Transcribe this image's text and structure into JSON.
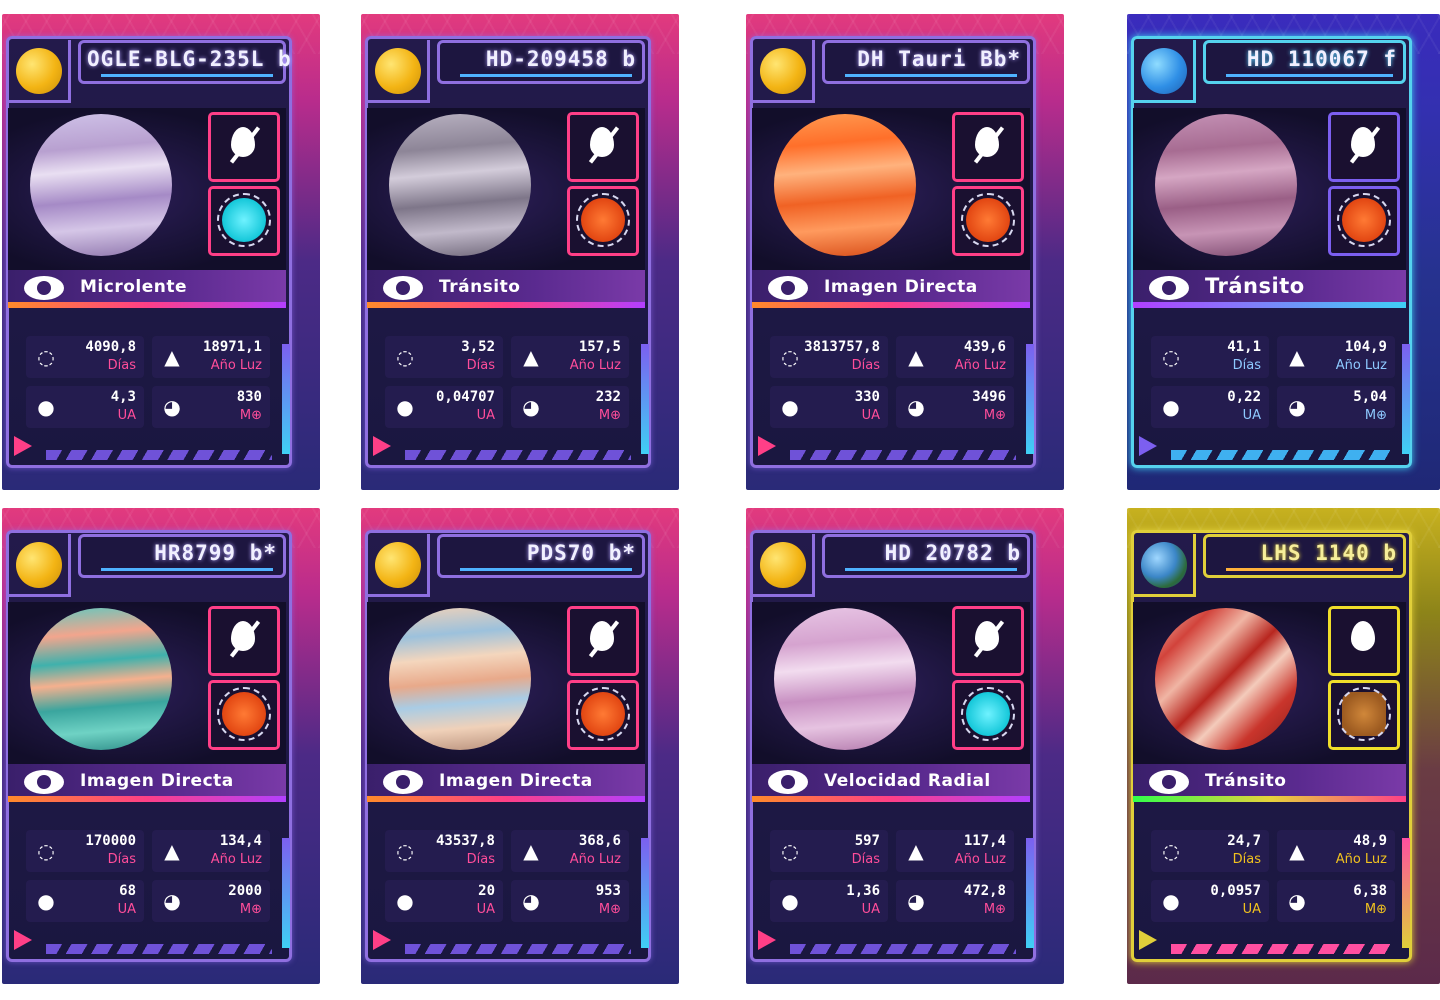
{
  "cards": [
    {
      "title": "OGLE-BLG-235L b",
      "method": "Microlente",
      "stats": [
        {
          "value": "4090,8",
          "unit": "Días"
        },
        {
          "value": "18971,1",
          "unit": "Año Luz"
        },
        {
          "value": "4,3",
          "unit": "UA"
        },
        {
          "value": "830",
          "unit": "M⊕"
        }
      ]
    },
    {
      "title": "HD-209458 b",
      "method": "Tránsito",
      "stats": [
        {
          "value": "3,52",
          "unit": "Días"
        },
        {
          "value": "157,5",
          "unit": "Año Luz"
        },
        {
          "value": "0,04707",
          "unit": "UA"
        },
        {
          "value": "232",
          "unit": "M⊕"
        }
      ]
    },
    {
      "title": "DH Tauri Bb*",
      "method": "Imagen Directa",
      "stats": [
        {
          "value": "3813757,8",
          "unit": "Días"
        },
        {
          "value": "439,6",
          "unit": "Año Luz"
        },
        {
          "value": "330",
          "unit": "UA"
        },
        {
          "value": "3496",
          "unit": "M⊕"
        }
      ]
    },
    {
      "title": "HD 110067 f",
      "method": "Tránsito",
      "stats": [
        {
          "value": "41,1",
          "unit": "Días"
        },
        {
          "value": "104,9",
          "unit": "Año Luz"
        },
        {
          "value": "0,22",
          "unit": "UA"
        },
        {
          "value": "5,04",
          "unit": "M⊕"
        }
      ]
    },
    {
      "title": "HR8799 b*",
      "method": "Imagen Directa",
      "stats": [
        {
          "value": "170000",
          "unit": "Días"
        },
        {
          "value": "134,4",
          "unit": "Año Luz"
        },
        {
          "value": "68",
          "unit": "UA"
        },
        {
          "value": "2000",
          "unit": "M⊕"
        }
      ]
    },
    {
      "title": "PDS70 b*",
      "method": "Imagen Directa",
      "stats": [
        {
          "value": "43537,8",
          "unit": "Días"
        },
        {
          "value": "368,6",
          "unit": "Año Luz"
        },
        {
          "value": "20",
          "unit": "UA"
        },
        {
          "value": "953",
          "unit": "M⊕"
        }
      ]
    },
    {
      "title": "HD 20782 b",
      "method": "Velocidad Radial",
      "stats": [
        {
          "value": "597",
          "unit": "Días"
        },
        {
          "value": "117,4",
          "unit": "Año Luz"
        },
        {
          "value": "1,36",
          "unit": "UA"
        },
        {
          "value": "472,8",
          "unit": "M⊕"
        }
      ]
    },
    {
      "title": "LHS 1140 b",
      "method": "Tránsito",
      "stats": [
        {
          "value": "24,7",
          "unit": "Días"
        },
        {
          "value": "48,9",
          "unit": "Año Luz"
        },
        {
          "value": "0,0957",
          "unit": "UA"
        },
        {
          "value": "6,38",
          "unit": "M⊕"
        }
      ]
    }
  ]
}
